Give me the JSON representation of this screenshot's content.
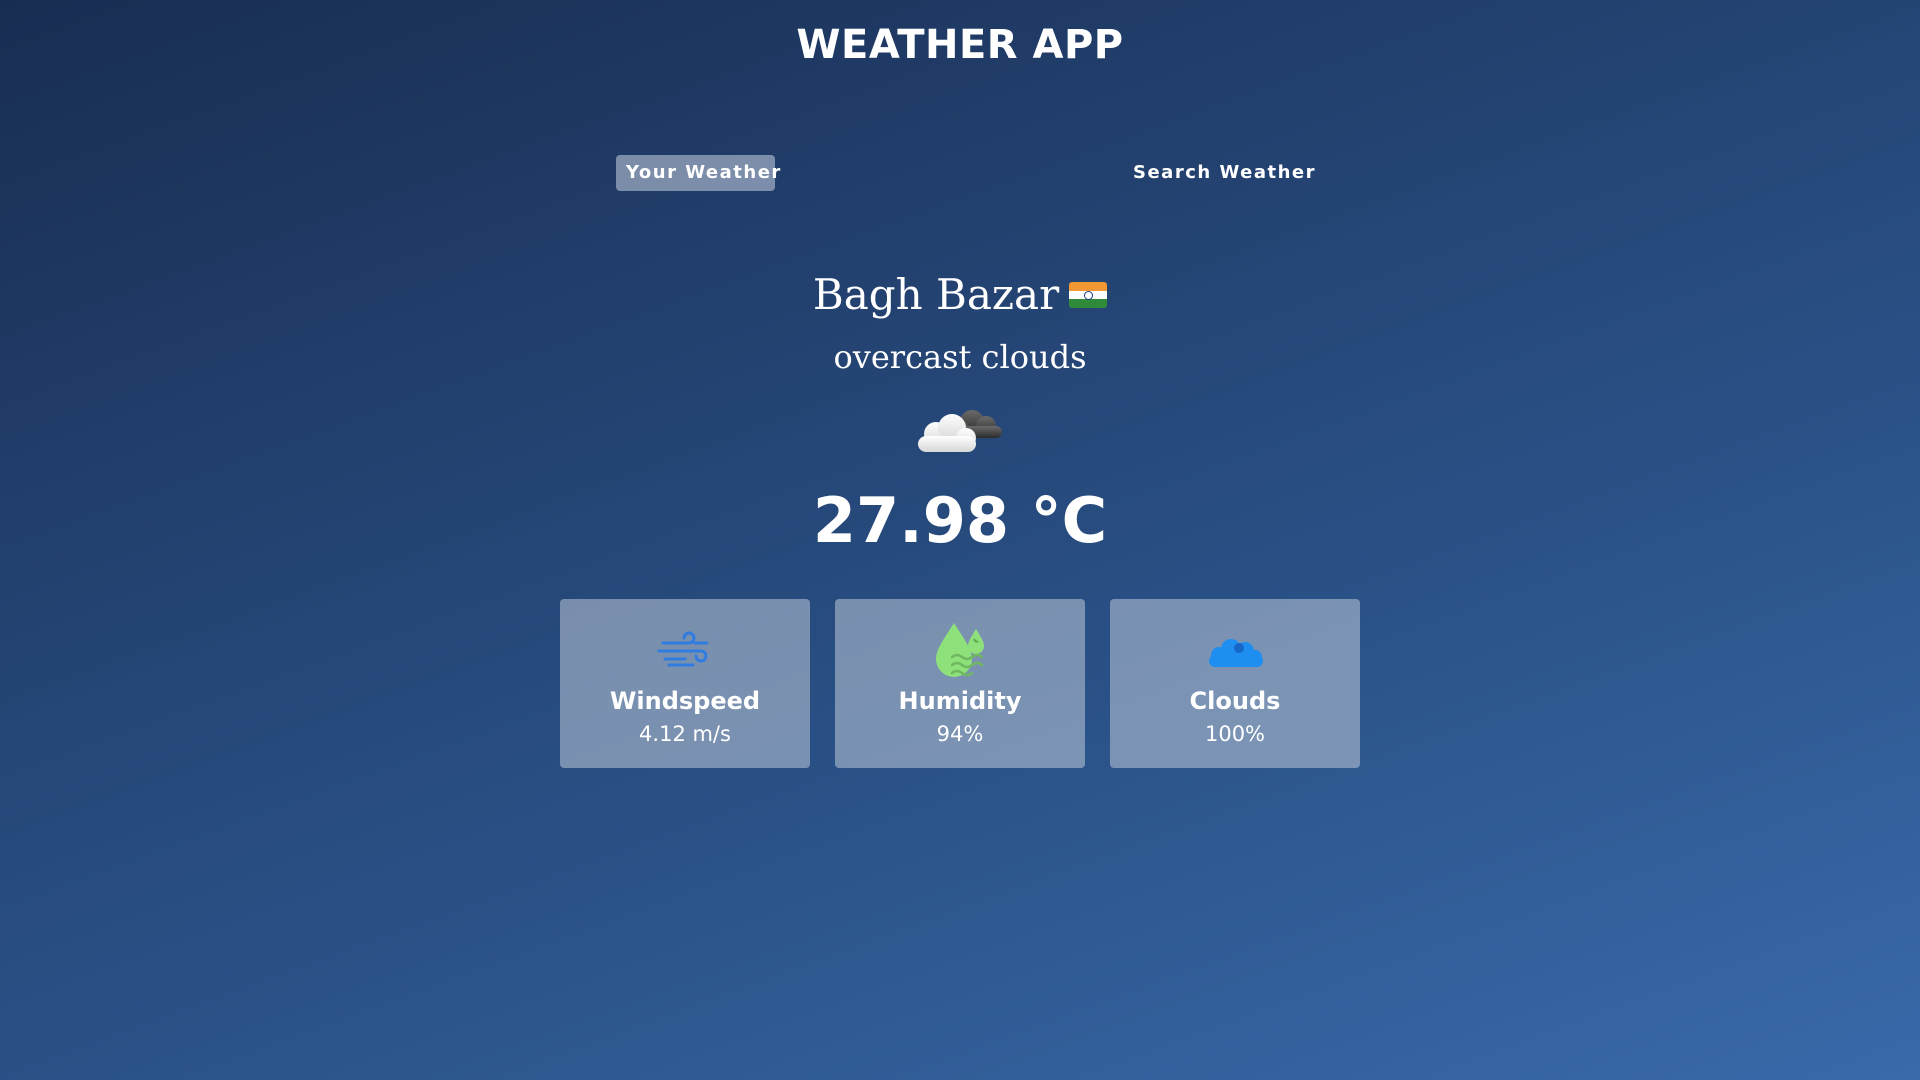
{
  "app": {
    "title": "WEATHER APP"
  },
  "tabs": [
    {
      "label": "Your Weather",
      "active": true
    },
    {
      "label": "Search Weather",
      "active": false
    }
  ],
  "weather": {
    "city": "Bagh Bazar",
    "country_flag_icon": "india-flag-icon",
    "description": "overcast clouds",
    "condition_icon": "overcast-clouds-icon",
    "temperature": "27.98 °C"
  },
  "stats": [
    {
      "icon": "wind-icon",
      "label": "Windspeed",
      "value": "4.12 m/s"
    },
    {
      "icon": "humidity-icon",
      "label": "Humidity",
      "value": "94%"
    },
    {
      "icon": "clouds-icon",
      "label": "Clouds",
      "value": "100%"
    }
  ],
  "colors": {
    "background_top": "#182d52",
    "background_bottom": "#3a6aaa",
    "card_background": "#8a9ebf",
    "wind_icon": "#2f7de1",
    "humidity_icon": "#8ee07a",
    "clouds_icon": "#1e8ff0"
  }
}
